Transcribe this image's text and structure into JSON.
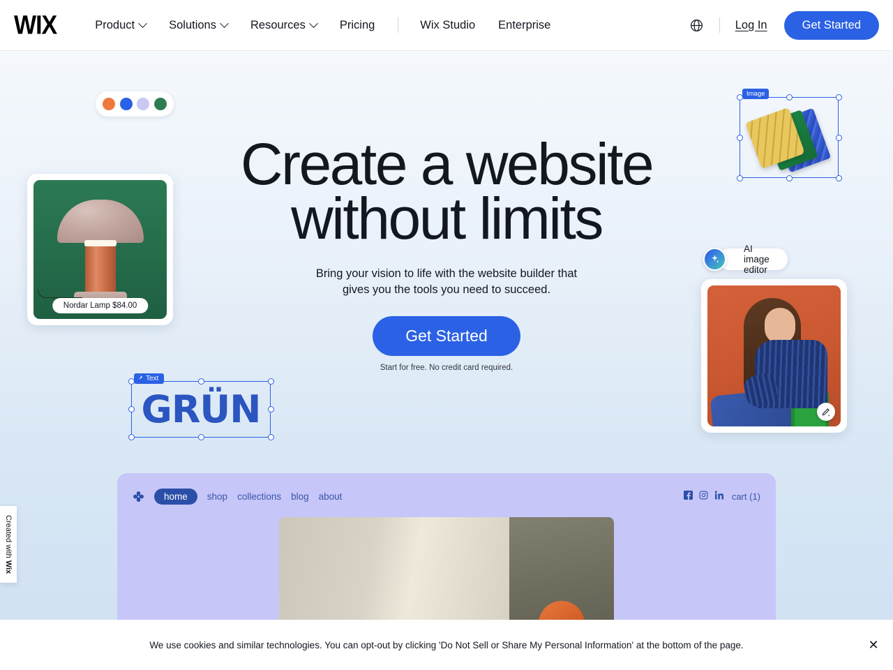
{
  "header": {
    "logo": "WIX",
    "nav": [
      {
        "label": "Product",
        "has_dropdown": true
      },
      {
        "label": "Solutions",
        "has_dropdown": true
      },
      {
        "label": "Resources",
        "has_dropdown": true
      },
      {
        "label": "Pricing",
        "has_dropdown": false
      },
      {
        "label": "Wix Studio",
        "has_dropdown": false
      },
      {
        "label": "Enterprise",
        "has_dropdown": false
      }
    ],
    "language_icon": "globe-icon",
    "login_label": "Log In",
    "cta_label": "Get Started"
  },
  "hero": {
    "title_line1": "Create a website",
    "title_line2": "without limits",
    "subtitle_line1": "Bring your vision to life with the website builder that",
    "subtitle_line2": "gives you the tools you need to succeed.",
    "cta_label": "Get Started",
    "note": "Start for free. No credit card required."
  },
  "swatches": {
    "colors": [
      "#f0783c",
      "#2b61e4",
      "#c8c9f5",
      "#2e7d52"
    ]
  },
  "product_card": {
    "label": "Nordar Lamp $84.00"
  },
  "text_element": {
    "badge_label": "Text",
    "badge_icon": "pin-icon",
    "value": "GRÜN"
  },
  "image_element": {
    "badge_label": "Image"
  },
  "ai_editor": {
    "icon": "sparkle-icon",
    "label": "AI image editor"
  },
  "photo_card": {
    "edit_icon": "magic-pencil-icon"
  },
  "site_preview": {
    "logo_icon": "flower-logo-icon",
    "active_link": "home",
    "links": [
      "shop",
      "collections",
      "blog",
      "about"
    ],
    "social": [
      "facebook-icon",
      "instagram-icon",
      "linkedin-icon"
    ],
    "cart_label": "cart (1)"
  },
  "side_tab": {
    "prefix": "Created with ",
    "brand": "Wix"
  },
  "cookie_banner": {
    "text": "We use cookies and similar technologies. You can opt-out by clicking 'Do Not Sell or Share My Personal Information' at the bottom of the page.",
    "close_label": "✕"
  },
  "colors": {
    "brand_blue": "#2b61e4",
    "preview_lavender": "#c6c6f8",
    "text_dark": "#131720"
  }
}
